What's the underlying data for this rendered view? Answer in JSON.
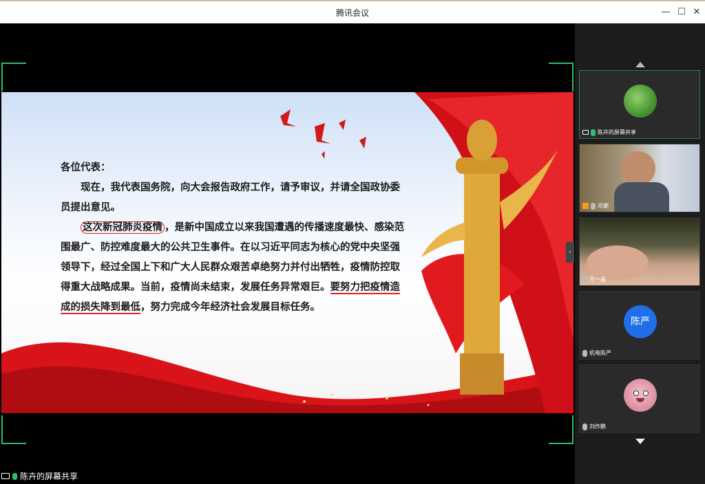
{
  "window": {
    "title": "腾讯会议",
    "controls": [
      "minimize-icon",
      "maximize-icon",
      "close-icon"
    ]
  },
  "slide": {
    "greeting": "各位代表：",
    "paragraph1": "现在，我代表国务院，向大会报告政府工作，请予审议，并请全国政协委员提出意见。",
    "paragraph2_highlight1": "这次新冠肺炎疫情",
    "paragraph2_part1": "，是新中国成立以来我国遭遇的传播速度最快、感染范围最广、防控难度最大的公共卫生事件。在以习近平同志为核心的党中央坚强领导下，经过全国上下和广大人民群众艰苦卓绝努力并付出牺牲，疫情防控取得重大战略成果。当前，疫情尚未结束，发展任务异常艰巨。",
    "paragraph2_highlight2": "要努力把疫情造成的损失降到最低",
    "paragraph2_part2": "，努力完成今年经济社会发展目标任务。"
  },
  "share_label": "陈卉的屏幕共享",
  "participants": [
    {
      "label": "陈卉的屏幕共享",
      "type": "avatar",
      "icon": "screen-share-icon",
      "mic": "on",
      "active": true
    },
    {
      "label": "邓娜",
      "type": "video",
      "mic": "muted"
    },
    {
      "label": "方一晶",
      "type": "video",
      "mic": "muted"
    },
    {
      "label": "机电陈严",
      "type": "initials",
      "initials": "陈严",
      "color": "#1e6fe8",
      "mic": "muted"
    },
    {
      "label": "刘作鹏",
      "type": "avatar",
      "mic": "muted"
    }
  ],
  "colors": {
    "accent_green": "#2fbf71",
    "highlight_red": "#dd2222",
    "initials_blue": "#1e6fe8"
  }
}
